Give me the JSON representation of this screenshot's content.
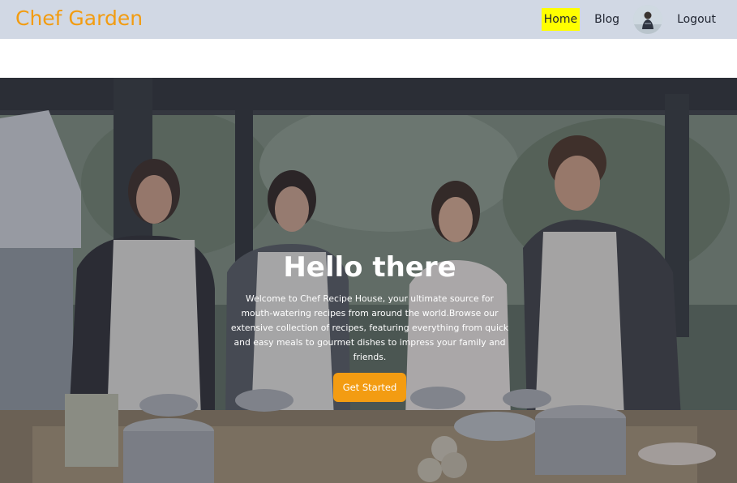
{
  "navbar": {
    "brand": "Chef Garden",
    "links": {
      "home": "Home",
      "blog": "Blog",
      "logout": "Logout"
    },
    "colors": {
      "background": "#d1d8e4",
      "brand": "#f29c11",
      "active_highlight": "#ffff00"
    }
  },
  "hero": {
    "title": "Hello there",
    "description": "Welcome to Chef Recipe House, your ultimate source for mouth-watering recipes from around the world.Browse our extensive collection of recipes, featuring everything from quick and easy meals to gourmet dishes to impress your family and friends.",
    "cta_label": "Get Started",
    "colors": {
      "cta": "#f39c12"
    }
  }
}
